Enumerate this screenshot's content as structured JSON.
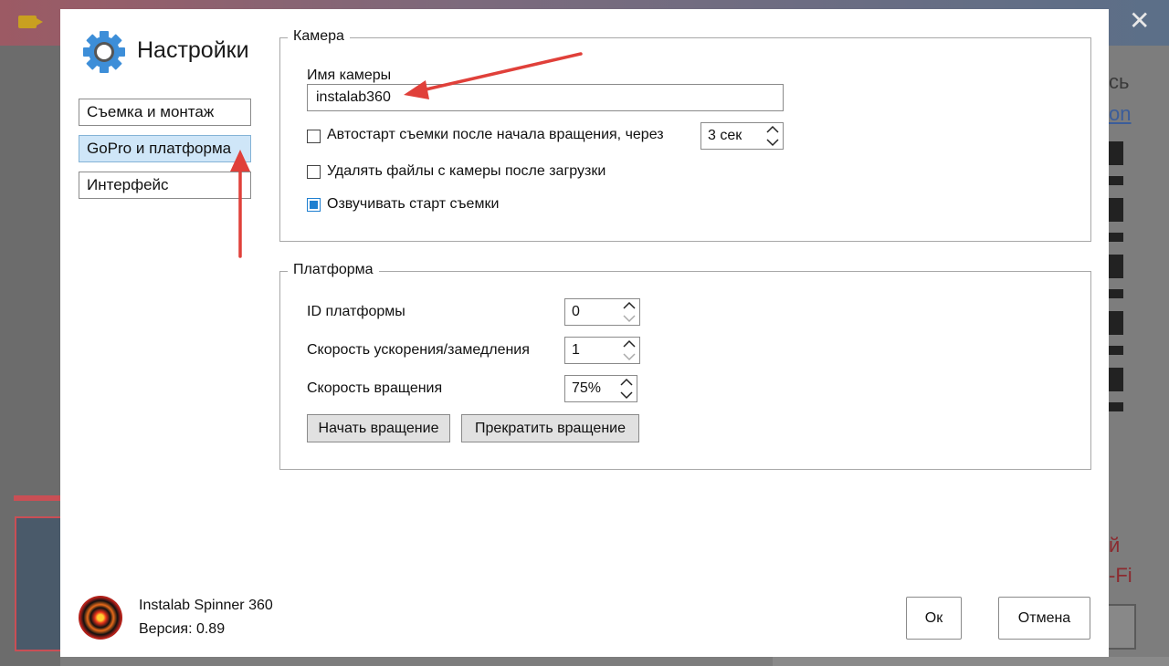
{
  "background": {
    "partial_text_1": "сь",
    "partial_text_2": "on",
    "partial_text_3": "й",
    "partial_text_4": "-Fi"
  },
  "dialog": {
    "title": "Настройки",
    "nav": [
      {
        "label": "Съемка и монтаж",
        "active": false
      },
      {
        "label": "GoPro и платформа",
        "active": true
      },
      {
        "label": "Интерфейс",
        "active": false
      }
    ],
    "camera_group": {
      "title": "Камера",
      "name_label": "Имя камеры",
      "name_value": "instalab360",
      "autostart_label": "Автостарт съемки после начала вращения, через",
      "autostart_checked": false,
      "autostart_delay": "3 сек",
      "delete_label": "Удалять файлы с камеры после загрузки",
      "delete_checked": false,
      "voice_label": "Озвучивать старт съемки",
      "voice_checked": true
    },
    "platform_group": {
      "title": "Платформа",
      "id_label": "ID платформы",
      "id_value": "0",
      "accel_label": "Скорость ускорения/замедления",
      "accel_value": "1",
      "speed_label": "Скорость вращения",
      "speed_value": "75%",
      "start_button": "Начать вращение",
      "stop_button": "Прекратить вращение"
    },
    "app_name": "Instalab Spinner 360",
    "version": "Версия: 0.89",
    "ok_button": "Ок",
    "cancel_button": "Отмена"
  },
  "colors": {
    "accent": "#1e7fd0",
    "nav_active_bg": "#cfe6f8",
    "annotation_arrow": "#e0403a",
    "gear": "#3d8ed8"
  }
}
